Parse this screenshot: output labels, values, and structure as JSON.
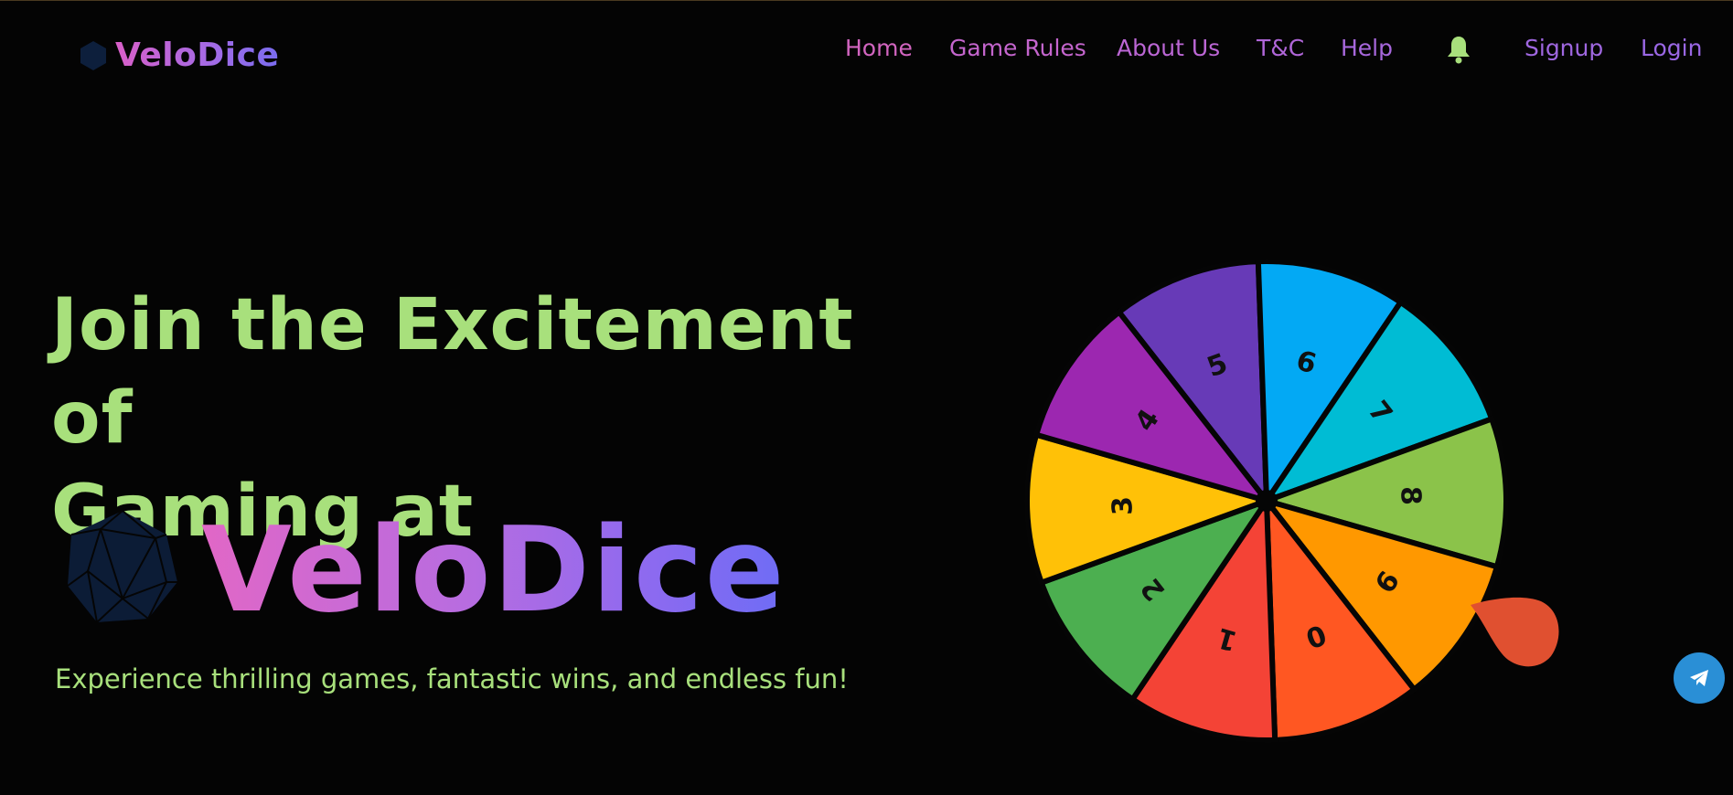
{
  "brand": {
    "name": "VeloDice"
  },
  "nav": {
    "items": [
      {
        "label": "Home",
        "color": "#d265c0"
      },
      {
        "label": "Game Rules",
        "color": "#c465cd"
      },
      {
        "label": "About Us",
        "color": "#bb66d4"
      },
      {
        "label": "T&C",
        "color": "#b066d8"
      },
      {
        "label": "Help",
        "color": "#a767dc"
      },
      {
        "label": "Signup",
        "color": "#9f67e0"
      },
      {
        "label": "Login",
        "color": "#9a67e4"
      }
    ],
    "bell_icon": "bell-icon",
    "bell_color": "#a8e07c"
  },
  "hero": {
    "headline_line1": "Join the Excitement of",
    "headline_line2": "Gaming at",
    "brand_big": "VeloDice",
    "tagline": "Experience thrilling games, fantastic wins, and endless fun!",
    "accent_green": "#a8e07c"
  },
  "wheel": {
    "segments": [
      {
        "label": "5",
        "color": "#673ab7"
      },
      {
        "label": "6",
        "color": "#03a9f4"
      },
      {
        "label": "7",
        "color": "#00bcd4"
      },
      {
        "label": "8",
        "color": "#8bc34a"
      },
      {
        "label": "9",
        "color": "#ff9800"
      },
      {
        "label": "0",
        "color": "#ff5722"
      },
      {
        "label": "1",
        "color": "#f44336"
      },
      {
        "label": "2",
        "color": "#4caf50"
      },
      {
        "label": "3",
        "color": "#ffc107"
      },
      {
        "label": "4",
        "color": "#9c27b0"
      }
    ],
    "pointer_color": "#e05030"
  },
  "telegram": {
    "icon": "telegram-icon",
    "color": "#2a8fd6"
  }
}
